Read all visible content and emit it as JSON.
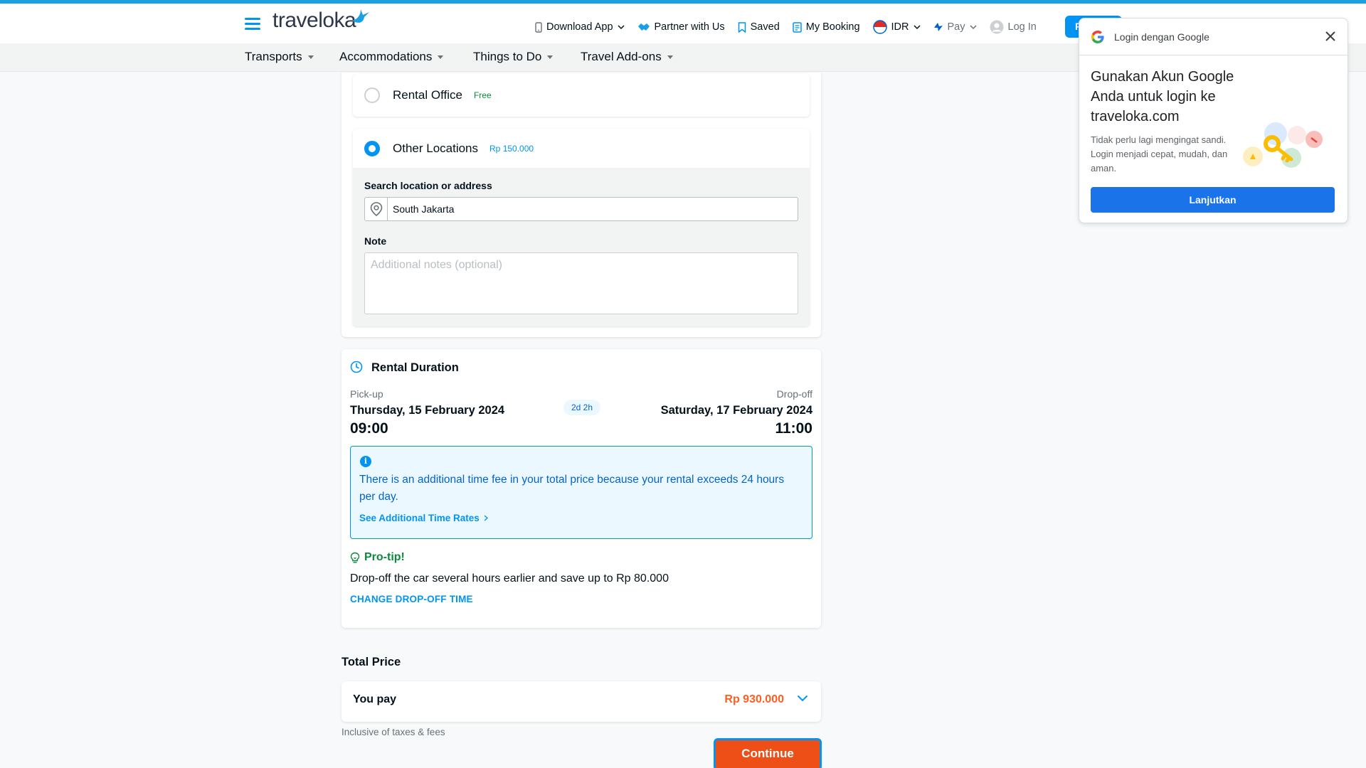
{
  "brand": {
    "logo_text": "traveloka"
  },
  "topnav": {
    "download_app": "Download App",
    "partner": "Partner with Us",
    "saved": "Saved",
    "my_booking": "My Booking",
    "currency": "IDR",
    "pay": "Pay",
    "login": "Log In",
    "register_visible": "R"
  },
  "subnav": {
    "items": [
      "Transports",
      "Accommodations",
      "Things to Do",
      "Travel Add-ons"
    ]
  },
  "dropoff_location": {
    "rental_office": {
      "label": "Rental Office",
      "tag": "Free"
    },
    "other_locations": {
      "label": "Other Locations",
      "tag": "Rp 150.000"
    },
    "search_label": "Search location or address",
    "search_value": "South Jakarta",
    "note_label": "Note",
    "note_placeholder": "Additional notes (optional)"
  },
  "rental_duration": {
    "title": "Rental Duration",
    "pickup_label": "Pick-up",
    "pickup_date": "Thursday, 15 February 2024",
    "pickup_time": "09:00",
    "duration": "2d 2h",
    "dropoff_label": "Drop-off",
    "dropoff_date": "Saturday, 17 February 2024",
    "dropoff_time": "11:00",
    "info_text": "There is an additional time fee in your total price because your rental exceeds 24 hours per day.",
    "info_link": "See Additional Time Rates",
    "protip_title": "Pro-tip!",
    "protip_text": "Drop-off the car several hours earlier and save up to Rp 80.000",
    "change_link": "CHANGE DROP-OFF TIME"
  },
  "total": {
    "title": "Total Price",
    "you_pay": "You pay",
    "amount": "Rp 930.000",
    "inclusive": "Inclusive of taxes & fees",
    "continue": "Continue"
  },
  "google_login": {
    "header": "Login dengan Google",
    "title": "Gunakan Akun Google Anda untuk login ke traveloka.com",
    "subtitle": "Tidak perlu lagi mengingat sandi. Login menjadi cepat, mudah, dan aman.",
    "button": "Lanjutkan"
  },
  "colors": {
    "accent": "#0194f3",
    "price": "#ff5e1f",
    "continue_bg": "#ee4f16",
    "success": "#0a8a3a",
    "google_blue": "#1a73e8"
  },
  "icons": [
    "menu-icon",
    "phone-icon",
    "handshake-icon",
    "bookmark-icon",
    "booking-icon",
    "flag-indonesia-icon",
    "pay-icon",
    "user-icon",
    "location-pin-icon",
    "clock-icon",
    "info-icon",
    "bulb-icon",
    "chevron-down-icon",
    "close-icon",
    "google-logo-icon"
  ]
}
